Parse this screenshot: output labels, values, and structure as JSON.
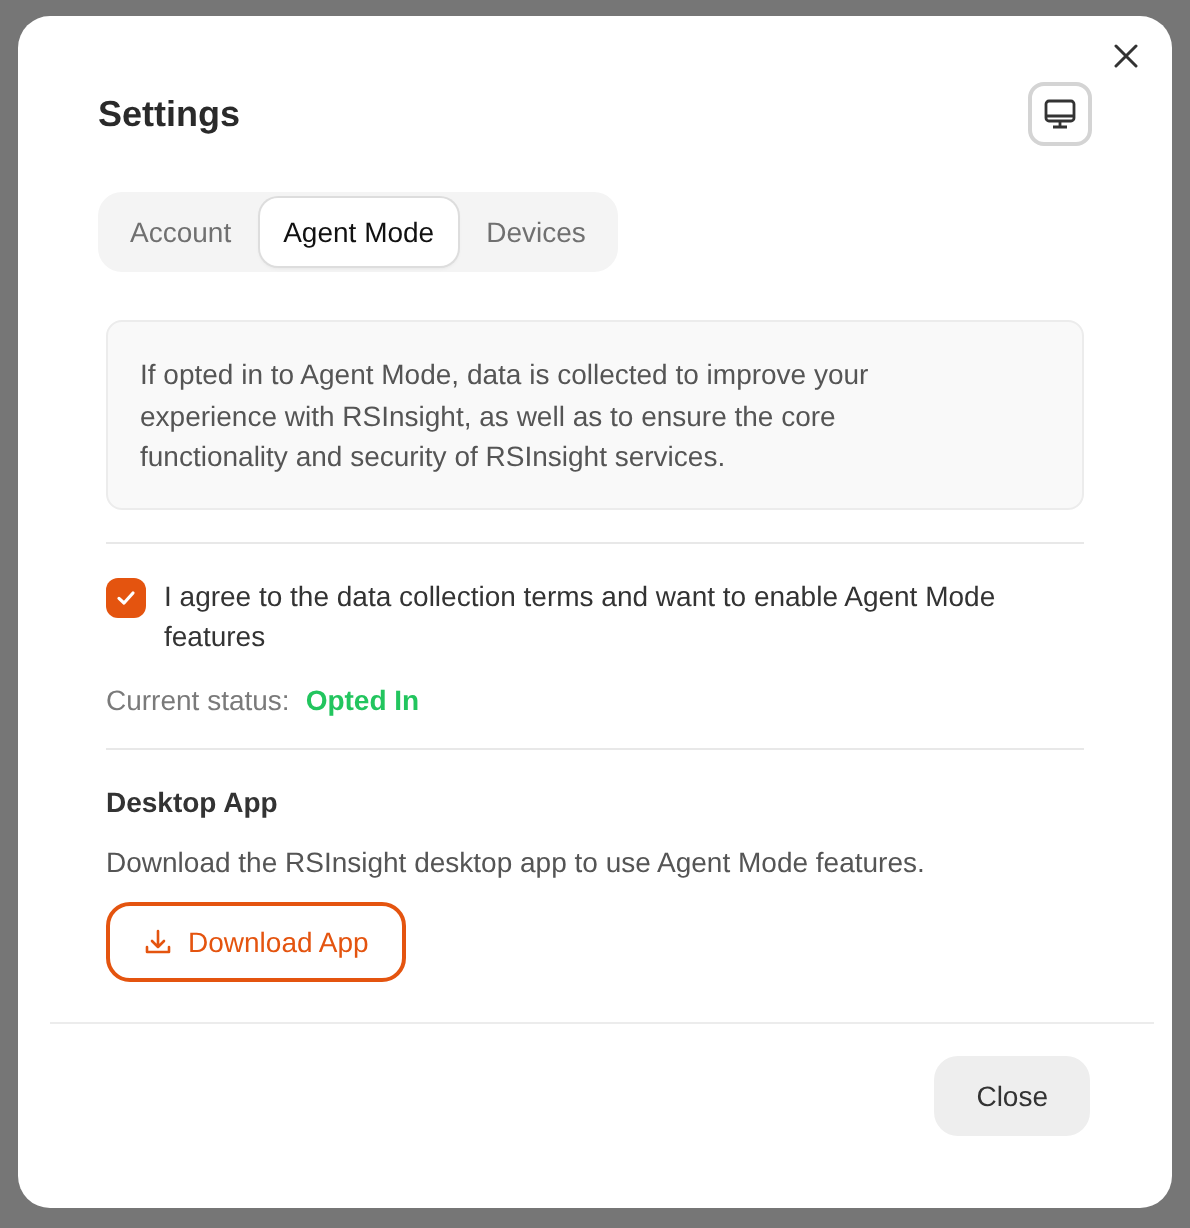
{
  "dialog": {
    "title": "Settings"
  },
  "tabs": [
    {
      "label": "Account",
      "selected": false
    },
    {
      "label": "Agent Mode",
      "selected": true
    },
    {
      "label": "Devices",
      "selected": false
    }
  ],
  "info": "If opted in to Agent Mode, data is collected to improve your experience with RSInsight, as well as to ensure the core functionality and security of RSInsight services.",
  "consent": {
    "label": "I agree to the data collection terms and want to enable Agent Mode features",
    "checked": true
  },
  "status": {
    "label": "Current status:",
    "value": "Opted In"
  },
  "desktop": {
    "heading": "Desktop App",
    "description": "Download the RSInsight desktop app to use Agent Mode features.",
    "button": "Download App"
  },
  "footer": {
    "button": "Close"
  }
}
